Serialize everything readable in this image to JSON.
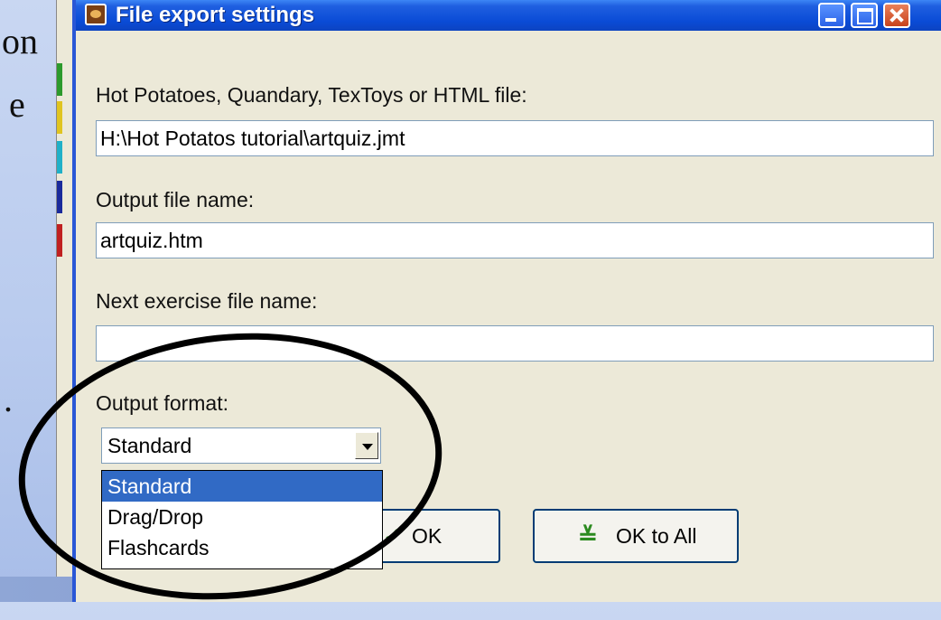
{
  "slide": {
    "fragment_1": "on",
    "fragment_2": "e",
    "fragment_3": "."
  },
  "dialog": {
    "title": "File export settings",
    "source_label": "Hot Potatoes, Quandary, TexToys or HTML file:",
    "source_value": "H:\\Hot Potatos tutorial\\artquiz.jmt",
    "output_label": "Output file name:",
    "output_value": "artquiz.htm",
    "next_label": "Next exercise file name:",
    "next_value": "",
    "format_label": "Output format:",
    "format_selected": "Standard",
    "format_options": [
      "Standard",
      "Drag/Drop",
      "Flashcards"
    ],
    "ok_label": "OK",
    "ok_all_label": "OK to All",
    "icons": {
      "app": "hot-potatoes-icon",
      "ok": "checkmark-icon",
      "ok_all": "double-checkmark-icon"
    }
  },
  "colors": {
    "titlebar": "#0a4bd6",
    "selection": "#316ac5",
    "annotation": "#000000"
  }
}
